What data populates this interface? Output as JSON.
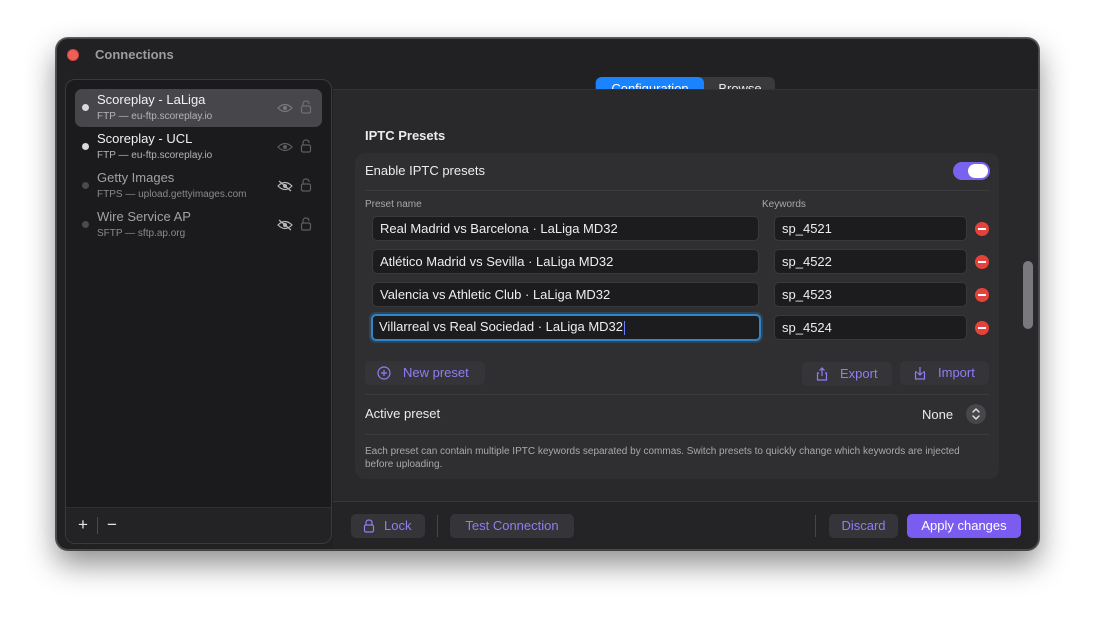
{
  "window": {
    "title": "Connections"
  },
  "sidebar": {
    "items": [
      {
        "name": "Scoreplay - LaLiga",
        "host": "FTP — eu-ftp.scoreplay.io",
        "selected": true,
        "status_color": "#d9d9dc"
      },
      {
        "name": "Scoreplay - UCL",
        "host": "FTP — eu-ftp.scoreplay.io",
        "selected": false,
        "status_color": "#d9d9dc"
      },
      {
        "name": "Getty Images",
        "host": "FTPS — upload.gettyimages.com",
        "selected": false,
        "status_color": "#4a4a4d"
      },
      {
        "name": "Wire Service AP",
        "host": "SFTP — sftp.ap.org",
        "selected": false,
        "status_color": "#4a4a4d"
      }
    ],
    "add_label": "+",
    "remove_label": "−"
  },
  "tabs": [
    {
      "label": "Configuration",
      "active": true
    },
    {
      "label": "Browse",
      "active": false
    }
  ],
  "iptc": {
    "section_title": "IPTC Presets",
    "enable_label": "Enable IPTC presets",
    "enabled": true,
    "col_preset_name": "Preset name",
    "col_keywords": "Keywords",
    "presets": [
      {
        "name": "Real Madrid vs Barcelona · LaLiga MD32",
        "keywords": "sp_4521"
      },
      {
        "name": "Atlético Madrid vs Sevilla · LaLiga MD32",
        "keywords": "sp_4522"
      },
      {
        "name": "Valencia vs Athletic Club · LaLiga MD32",
        "keywords": "sp_4523"
      },
      {
        "name": "Villarreal vs Real Sociedad · LaLiga MD32",
        "keywords": "sp_4524"
      }
    ],
    "new_preset_label": "New preset",
    "export_label": "Export",
    "import_label": "Import",
    "active_preset_label": "Active preset",
    "active_preset_value": "None",
    "help_text": "Each preset can contain multiple IPTC keywords separated by commas. Switch presets to quickly change which keywords are injected before uploading."
  },
  "footer": {
    "lock_label": "Lock",
    "test_label": "Test Connection",
    "discard_label": "Discard",
    "apply_label": "Apply changes"
  },
  "colors": {
    "accent": "#1a84ff",
    "brand": "#7b5cf0",
    "danger": "#e5423b"
  }
}
